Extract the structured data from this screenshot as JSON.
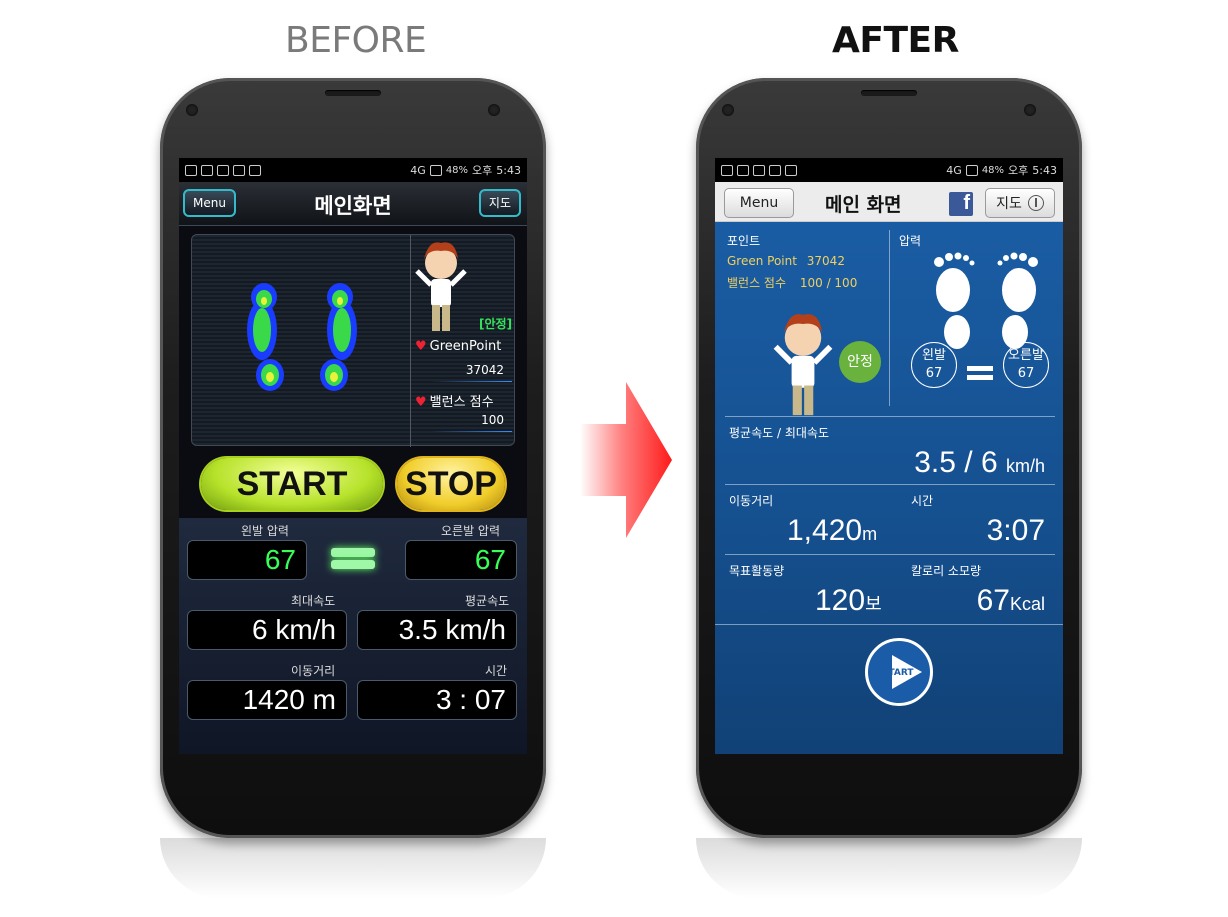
{
  "headings": {
    "before": "BEFORE",
    "after": "AFTER"
  },
  "status_bar": {
    "battery": "48%",
    "time_prefix": "오후",
    "time": "5:43",
    "network": "4G"
  },
  "before": {
    "menu_label": "Menu",
    "title": "메인화면",
    "map_label": "지도",
    "stable_badge": "[안정]",
    "green_point_label": "GreenPoint",
    "green_point_value": "37042",
    "balance_label": "밸런스 점수",
    "balance_value": "100",
    "start_label": "START",
    "stop_label": "STOP",
    "left_pressure_label": "왼발 압력",
    "left_pressure_value": "67",
    "right_pressure_label": "오른발 압력",
    "right_pressure_value": "67",
    "max_speed_label": "최대속도",
    "max_speed_value": "6 km/h",
    "avg_speed_label": "평균속도",
    "avg_speed_value": "3.5 km/h",
    "distance_label": "이동거리",
    "distance_value": "1420 m",
    "time_label": "시간",
    "time_value": "3 : 07"
  },
  "after": {
    "menu_label": "Menu",
    "title": "메인 화면",
    "facebook_glyph": "f",
    "map_label": "지도",
    "points_heading": "포인트",
    "green_point_label": "Green Point",
    "green_point_value": "37042",
    "balance_label": "밸런스 점수",
    "balance_value": "100 / 100",
    "stable_badge": "안정",
    "pressure_heading": "압력",
    "left_foot_label": "왼발",
    "left_foot_value": "67",
    "right_foot_label": "오른발",
    "right_foot_value": "67",
    "speed_heading": "평균속도 / 최대속도",
    "speed_value": "3.5 / 6",
    "speed_unit": "km/h",
    "distance_label": "이동거리",
    "distance_value": "1,420",
    "distance_unit": "m",
    "time_label": "시간",
    "time_value": "3:07",
    "target_label": "목표활동량",
    "target_value": "120",
    "target_unit": "보",
    "calorie_label": "칼로리 소모량",
    "calorie_value": "67",
    "calorie_unit": "Kcal",
    "start_label": "START"
  },
  "colors": {
    "before_accent": "#36ff57",
    "after_bg": "#1b5fa8",
    "arrow": "#ff1a1a",
    "stable_green": "#6ab23e"
  }
}
